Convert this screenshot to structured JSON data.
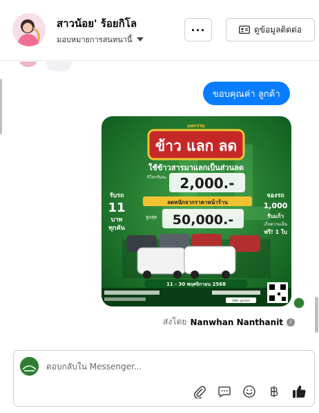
{
  "header": {
    "contact_name": "สาวน้อย' ร้อยกิโล",
    "assign_label": "มอบหมายการสนทนานี้",
    "more_label": "···",
    "contact_info_label": "ดูข้อมูลติดต่อ"
  },
  "thread": {
    "outgoing_message": "ขอบคุณค่า ลูกค้า",
    "promo": {
      "brand": "มหกรรม",
      "headline": "ข้าว แลก ลด",
      "subheadline": "ใช้ข้าวสารมาแลกเป็นส่วนลด",
      "per_kg_label": "กิโลกรัมละ",
      "per_kg_value": "2,000.-",
      "discount_label": "ลดหนักจากราคาหน้าร้าน",
      "max_label": "สูงสุด",
      "max_value": "50,000.-",
      "left_offer": [
        "รับรถ",
        "11",
        "บาท",
        "ทุกคัน"
      ],
      "right_offer": [
        "จองรถ",
        "1,000",
        "รับแก้ว",
        "เก็บความเย็น",
        "ฟรี! 1 ใบ"
      ],
      "date_range": "11 - 30 พฤศจิกายน 2568",
      "line_label": "LINE: @ckaul"
    },
    "sent_by_prefix": "ส่งโดย",
    "sent_by_name": "Nanwhan Nanthanit",
    "info_icon": "i"
  },
  "composer": {
    "placeholder": "ตอบกลับใน Messenger...",
    "tools": [
      "paperclip-icon",
      "quick-reply-icon",
      "emoji-icon",
      "baht-icon",
      "thumbs-up-icon"
    ]
  },
  "colors": {
    "accent_blue": "#0a7cff",
    "promo_green": "#1f7a2e",
    "promo_gold": "#f2c230",
    "promo_red": "#c62828"
  }
}
